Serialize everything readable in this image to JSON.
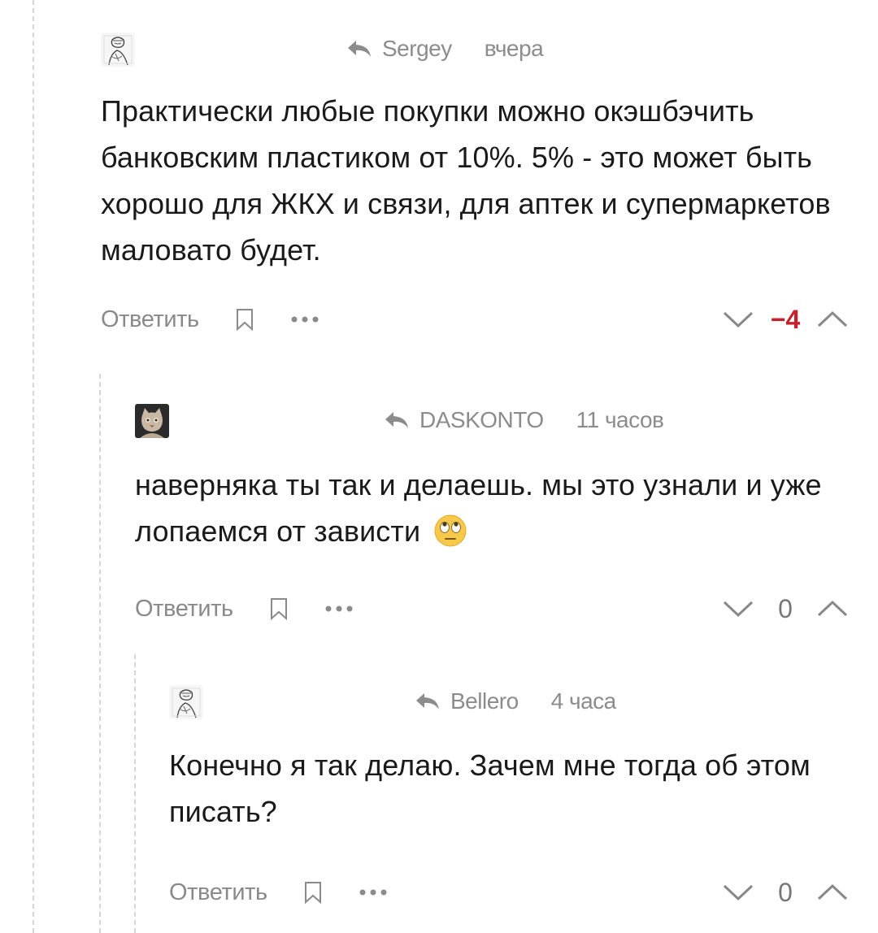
{
  "comments": [
    {
      "author": "Sergey",
      "time": "вчера",
      "text": "Практически любые покупки можно окэшбэчить банковским пластиком от 10%. 5% - это может быть хорошо для ЖКХ и связи, для аптек и супермаркетов маловато будет.",
      "reply_label": "Ответить",
      "rating": "−4",
      "avatar_icon": "sketch-portrait-avatar-icon"
    },
    {
      "author": "DASKONTO",
      "time": "11 часов",
      "text": "наверняка ты так и делаешь. мы это узнали и уже лопаемся от зависти",
      "emoji": "🙄",
      "reply_label": "Ответить",
      "rating": "0",
      "avatar_icon": "cat-avatar-icon"
    },
    {
      "author": "Bellero",
      "time": "4 часа",
      "text": "Конечно я так делаю. Зачем мне тогда об этом писать?",
      "reply_label": "Ответить",
      "rating": "0",
      "avatar_icon": "sketch-portrait-avatar-icon"
    }
  ],
  "colors": {
    "negative_rating": "#c8202a",
    "muted_text": "#8c8c8c",
    "thread_line": "#d6d6d6"
  }
}
